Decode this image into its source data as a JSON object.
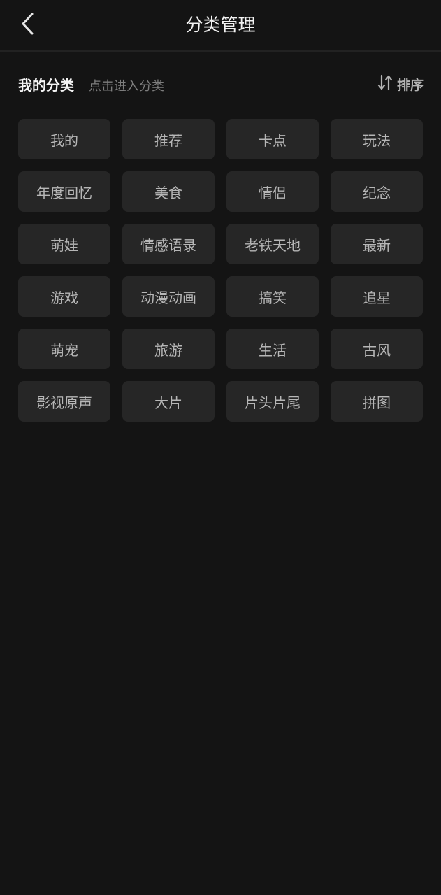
{
  "header": {
    "title": "分类管理",
    "back_icon": "chevron-left-icon"
  },
  "section": {
    "title": "我的分类",
    "hint": "点击进入分类",
    "sort_label": "排序",
    "sort_icon": "sort-arrows-icon"
  },
  "categories": [
    "我的",
    "推荐",
    "卡点",
    "玩法",
    "年度回忆",
    "美食",
    "情侣",
    "纪念",
    "萌娃",
    "情感语录",
    "老铁天地",
    "最新",
    "游戏",
    "动漫动画",
    "搞笑",
    "追星",
    "萌宠",
    "旅游",
    "生活",
    "古风",
    "影视原声",
    "大片",
    "片头片尾",
    "拼图"
  ],
  "colors": {
    "background": "#141414",
    "tag_background": "#262626",
    "tag_text": "#b7b7b7",
    "hint_text": "#7d7d7d"
  }
}
